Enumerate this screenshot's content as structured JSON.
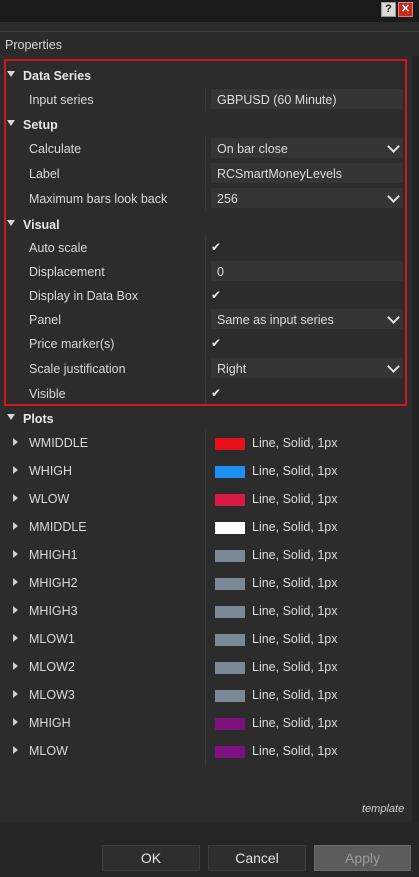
{
  "window": {
    "help_glyph": "?",
    "close_glyph": "✕"
  },
  "header": {
    "title": "Properties"
  },
  "categories": {
    "data_series": "Data Series",
    "setup": "Setup",
    "visual": "Visual",
    "plots": "Plots"
  },
  "data_series": {
    "input_series": {
      "label": "Input series",
      "value": "GBPUSD (60 Minute)"
    }
  },
  "setup": {
    "calculate": {
      "label": "Calculate",
      "value": "On bar close"
    },
    "name_label": {
      "label": "Label",
      "value": "RCSmartMoneyLevels"
    },
    "max_bars": {
      "label": "Maximum bars look back",
      "value": "256"
    }
  },
  "visual": {
    "auto_scale": {
      "label": "Auto scale",
      "checked": true
    },
    "displacement": {
      "label": "Displacement",
      "value": "0"
    },
    "display_in_data_box": {
      "label": "Display in Data Box",
      "checked": true
    },
    "panel": {
      "label": "Panel",
      "value": "Same as input series"
    },
    "price_markers": {
      "label": "Price marker(s)",
      "checked": true
    },
    "scale_justification": {
      "label": "Scale justification",
      "value": "Right"
    },
    "visible": {
      "label": "Visible",
      "checked": true
    }
  },
  "check_glyph": "✔",
  "plots": [
    {
      "name": "WMIDDLE",
      "color": "#e8101a",
      "style": "Line, Solid, 1px"
    },
    {
      "name": "WHIGH",
      "color": "#1f8ef1",
      "style": "Line, Solid, 1px"
    },
    {
      "name": "WLOW",
      "color": "#d81b46",
      "style": "Line, Solid, 1px"
    },
    {
      "name": "MMIDDLE",
      "color": "#ffffff",
      "style": "Line, Solid, 1px"
    },
    {
      "name": "MHIGH1",
      "color": "#7b8996",
      "style": "Line, Solid, 1px"
    },
    {
      "name": "MHIGH2",
      "color": "#7b8996",
      "style": "Line, Solid, 1px"
    },
    {
      "name": "MHIGH3",
      "color": "#7b8996",
      "style": "Line, Solid, 1px"
    },
    {
      "name": "MLOW1",
      "color": "#7b8996",
      "style": "Line, Solid, 1px"
    },
    {
      "name": "MLOW2",
      "color": "#7b8996",
      "style": "Line, Solid, 1px"
    },
    {
      "name": "MLOW3",
      "color": "#7b8996",
      "style": "Line, Solid, 1px"
    },
    {
      "name": "MHIGH",
      "color": "#7d1180",
      "style": "Line, Solid, 1px"
    },
    {
      "name": "MLOW",
      "color": "#7d1180",
      "style": "Line, Solid, 1px"
    }
  ],
  "footer": {
    "template_link": "template",
    "ok_label": "OK",
    "cancel_label": "Cancel",
    "apply_label": "Apply"
  }
}
